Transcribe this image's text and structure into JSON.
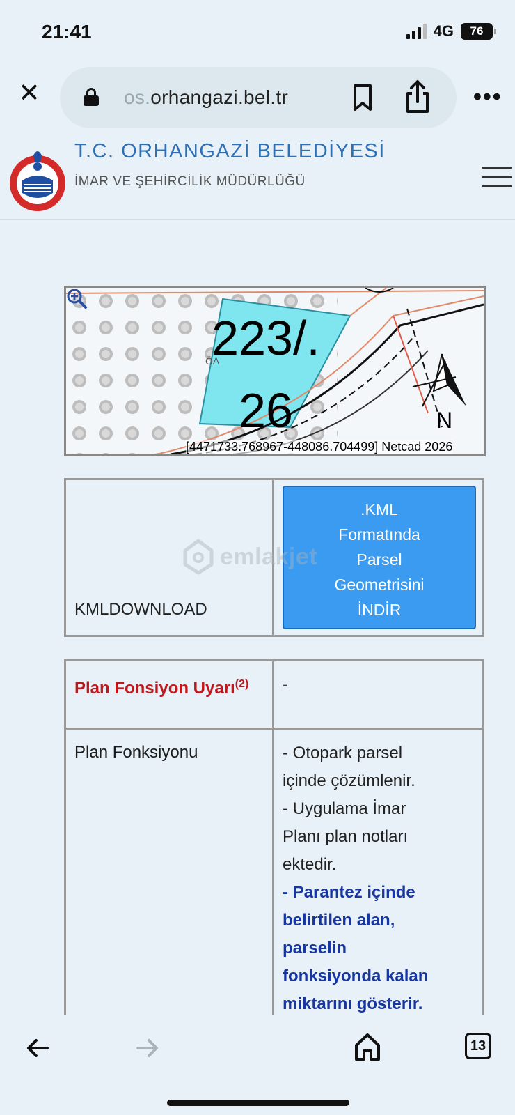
{
  "status_bar": {
    "time": "21:41",
    "network": "4G",
    "battery": "76"
  },
  "browser": {
    "url_faded": "os.",
    "url_main": "orhangazi.bel.tr",
    "tab_count": "13"
  },
  "site": {
    "title": "T.C. ORHANGAZİ BELEDİYESİ",
    "subtitle": "İMAR VE ŞEHİRCİLİK MÜDÜRLÜĞÜ"
  },
  "map": {
    "parcel_line1": "223/.",
    "parcel_line2": "26",
    "north": "N",
    "coordinates": "[4471733.768967-448086.704499] Netcad 2026",
    "zone_label": "ÖA"
  },
  "kml": {
    "label": "KMLDOWNLOAD",
    "button_lines": [
      ".KML",
      "Formatında",
      "Parsel",
      "Geometrisini",
      "İNDİR"
    ]
  },
  "watermark": "emlakjet",
  "info": {
    "warning_label": "Plan Fonsiyon Uyarı",
    "warning_sup": "(2)",
    "warning_value": "-",
    "function_label": "Plan Fonksiyonu",
    "function_lines": [
      "- Otopark parsel",
      "içinde çözümlenir.",
      "- Uygulama İmar",
      "Planı plan notları",
      "ektedir."
    ],
    "function_bold_lines": [
      "- Parantez içinde",
      "belirtilen alan,",
      "parselin",
      "fonksiyonda kalan",
      "miktarını gösterir."
    ]
  },
  "colors": {
    "accent": "#3a9bf1",
    "title_blue": "#2f6fb3",
    "warning_red": "#c0171c",
    "note_blue": "#1736a0",
    "parcel_fill": "#7fe6ef"
  }
}
